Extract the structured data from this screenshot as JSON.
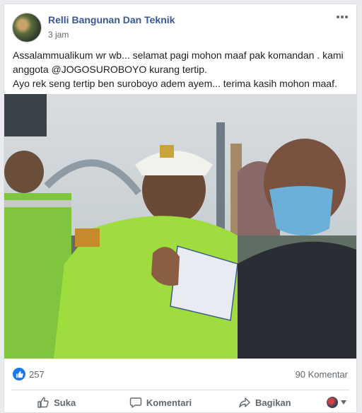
{
  "post": {
    "author": "Relli Bangunan Dan Teknik",
    "time": "3 jam",
    "text_line1": "Assalammualikum wr wb... selamat pagi mohon maaf pak komandan . kami anggota @JOGOSUROBOYO kurang tertip.",
    "text_line2": "Ayo rek seng tertip ben suroboyo adem ayem... terima kasih mohon maaf.",
    "photo_description_icon": "photo"
  },
  "stats": {
    "reactions": "257",
    "comments": "90 Komentar"
  },
  "actions": {
    "like": "Suka",
    "comment": "Komentari",
    "share": "Bagikan"
  },
  "colors": {
    "brand_blue": "#385898",
    "like_blue": "#1877f2",
    "muted": "#606770"
  }
}
